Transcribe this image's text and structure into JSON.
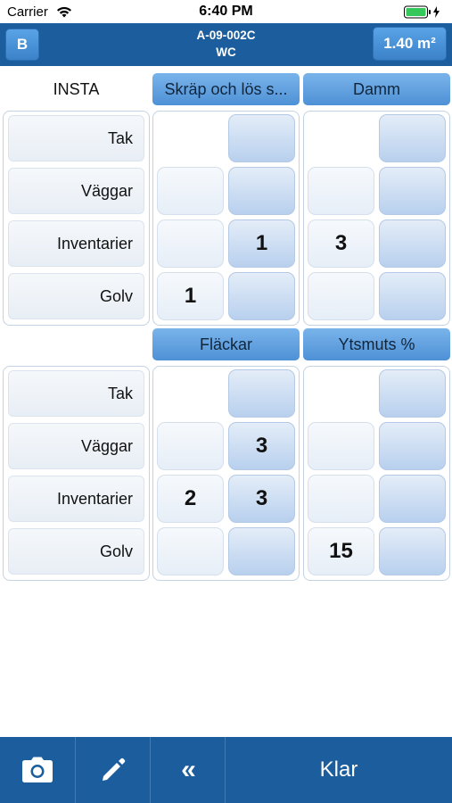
{
  "status_bar": {
    "carrier": "Carrier",
    "time": "6:40 PM"
  },
  "header": {
    "left_button": "B",
    "code": "A-09-002C",
    "room": "WC",
    "area": "1.40 m²"
  },
  "grid": {
    "corner_label": "INSTA",
    "categories": [
      "Skräp och lös s...",
      "Damm",
      "Fläckar",
      "Ytsmuts %"
    ],
    "rows": [
      "Tak",
      "Väggar",
      "Inventarier",
      "Golv"
    ],
    "groups": [
      {
        "category": "Skräp och lös s...",
        "values": [
          [
            "",
            ""
          ],
          [
            "",
            ""
          ],
          [
            "",
            "1"
          ],
          [
            "1",
            ""
          ]
        ]
      },
      {
        "category": "Damm",
        "values": [
          [
            "",
            ""
          ],
          [
            "",
            ""
          ],
          [
            "3",
            ""
          ],
          [
            "",
            ""
          ]
        ]
      },
      {
        "category": "Fläckar",
        "values": [
          [
            "",
            ""
          ],
          [
            "",
            "3"
          ],
          [
            "2",
            "3"
          ],
          [
            "",
            ""
          ]
        ]
      },
      {
        "category": "Ytsmuts %",
        "values": [
          [
            "",
            ""
          ],
          [
            "",
            ""
          ],
          [
            "",
            ""
          ],
          [
            "15",
            ""
          ]
        ]
      }
    ]
  },
  "toolbar": {
    "camera_icon": "camera-icon",
    "edit_icon": "pencil-icon",
    "back_label": "«",
    "done_label": "Klar"
  },
  "colors": {
    "bar": "#1b5d9d",
    "header_cell": "#5b9ce0"
  }
}
